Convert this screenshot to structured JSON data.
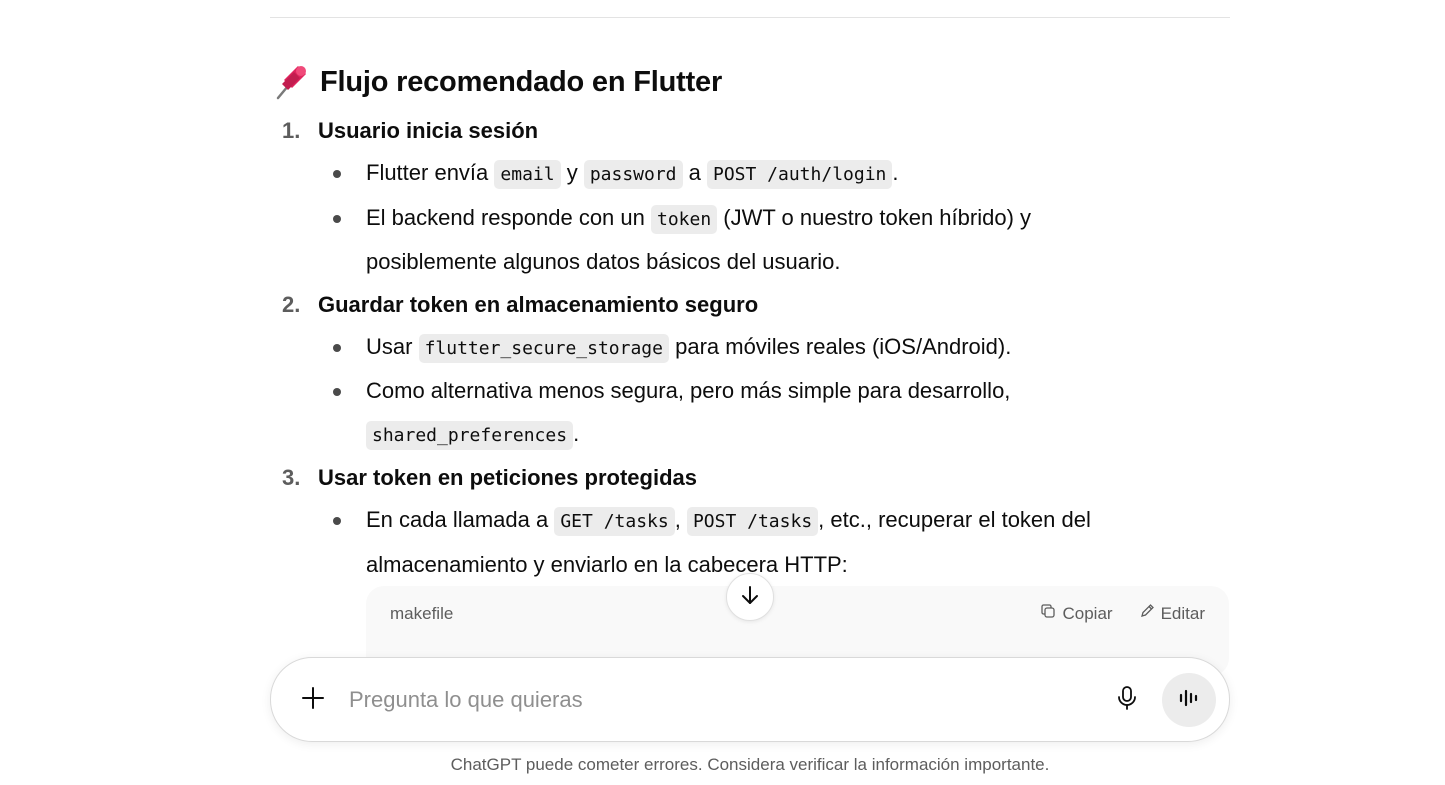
{
  "section": {
    "icon": "pushpin-icon",
    "title": "Flujo recomendado en Flutter"
  },
  "steps": [
    {
      "number": "1.",
      "title": "Usuario inicia sesión",
      "bullets": [
        {
          "t1": "Flutter envía ",
          "c1": "email",
          "t2": " y ",
          "c2": "password",
          "t3": " a ",
          "c3": "POST /auth/login",
          "t4": "."
        },
        {
          "t1": "El backend responde con un ",
          "c1": "token",
          "t2": " (JWT o nuestro token híbrido) y",
          "t3": "posiblemente algunos datos básicos del usuario."
        }
      ]
    },
    {
      "number": "2.",
      "title": "Guardar token en almacenamiento seguro",
      "bullets": [
        {
          "t1": "Usar ",
          "c1": "flutter_secure_storage",
          "t2": " para móviles reales (iOS/Android)."
        },
        {
          "t1": "Como alternativa menos segura, pero más simple para desarrollo,",
          "c1": "shared_preferences",
          "t2": "."
        }
      ]
    },
    {
      "number": "3.",
      "title": "Usar token en peticiones protegidas",
      "bullets": [
        {
          "t1": "En cada llamada a ",
          "c1": "GET /tasks",
          "t2": ", ",
          "c2": "POST /tasks",
          "t3": ", etc., recuperar el token del",
          "t4": "almacenamiento y enviarlo en la cabecera HTTP:"
        }
      ]
    }
  ],
  "code_block": {
    "language": "makefile",
    "copy_label": "Copiar",
    "edit_label": "Editar"
  },
  "composer": {
    "placeholder": "Pregunta lo que quieras"
  },
  "disclaimer": "ChatGPT puede cometer errores. Considera verificar la información importante."
}
